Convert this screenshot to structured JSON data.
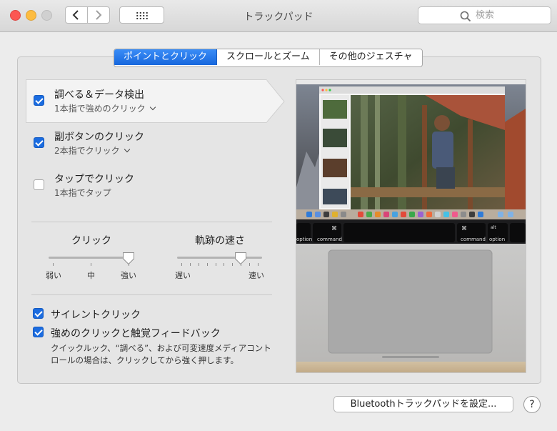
{
  "window": {
    "title": "トラックパッド"
  },
  "search": {
    "placeholder": "検索"
  },
  "tabs": [
    {
      "label": "ポイントとクリック",
      "active": true
    },
    {
      "label": "スクロールとズーム",
      "active": false
    },
    {
      "label": "その他のジェスチャ",
      "active": false
    }
  ],
  "options": [
    {
      "title": "調べる＆データ検出",
      "subtitle": "1本指で強めのクリック",
      "checked": true
    },
    {
      "title": "副ボタンのクリック",
      "subtitle": "2本指でクリック",
      "checked": true
    },
    {
      "title": "タップでクリック",
      "subtitle": "1本指でタップ",
      "checked": false
    }
  ],
  "sliders": {
    "click": {
      "label": "クリック",
      "min_label": "弱い",
      "mid_label": "中",
      "max_label": "強い",
      "value": 1.0
    },
    "tracking": {
      "label": "軌跡の速さ",
      "min_label": "遅い",
      "max_label": "速い",
      "value": 0.75
    }
  },
  "silent_click": {
    "label": "サイレントクリック",
    "checked": true
  },
  "force_click": {
    "label": "強めのクリックと触覚フィードバック",
    "checked": true,
    "description": "クイックルック、“調べる”、および可変速度メディアコントロールの場合は、クリックしてから強く押します。"
  },
  "keyboard": {
    "option_label": "option",
    "command_label": "command",
    "alt_glyph": "alt",
    "cmd_glyph": "⌘"
  },
  "buttons": {
    "bluetooth": "Bluetoothトラックパッドを設定...",
    "help": "?"
  },
  "icons": {
    "back": "chevron-left-icon",
    "forward": "chevron-right-icon",
    "grid": "grid-icon",
    "search": "search-icon"
  },
  "colors": {
    "accent": "#1b6ce0",
    "close": "#fc5753",
    "minimize": "#fdbc40"
  }
}
